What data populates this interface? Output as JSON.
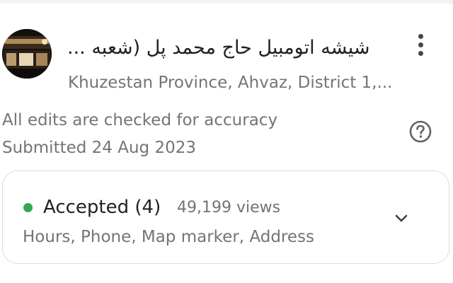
{
  "place": {
    "title": "شیشه اتومبیل حاج محمد پل (شعبه ...",
    "address": "Khuzestan Province, Ahvaz, District 1,...",
    "avatar_icon": "storefront-photo"
  },
  "menu": {
    "icon": "more-vert-icon"
  },
  "info": {
    "notice": "All edits are checked for accuracy",
    "submitted": "Submitted 24 Aug 2023",
    "help_icon": "help-circle-icon"
  },
  "edit_card": {
    "status": "Accepted (4)",
    "status_color": "#34a853",
    "views": "49,199 views",
    "fields": "Hours, Phone, Map marker, Address",
    "expand_icon": "chevron-down-icon"
  }
}
